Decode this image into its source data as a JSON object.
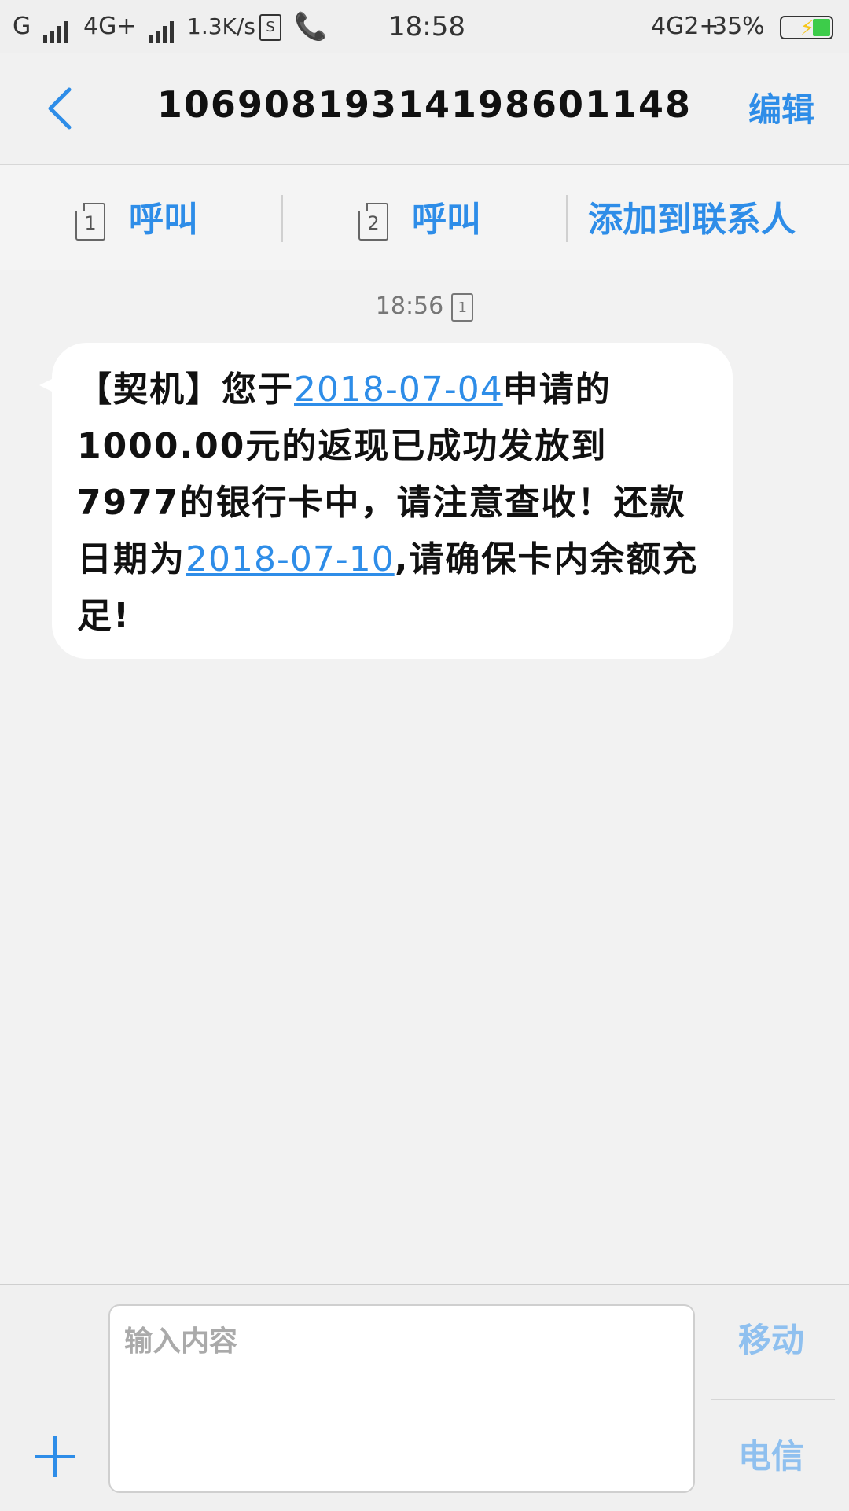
{
  "status_bar": {
    "carrier1": "G",
    "carrier2": "4G+",
    "speed": "1.3K/s",
    "sim_badge": "S",
    "time": "18:58",
    "network2": "4G2+",
    "battery_percent": "35%",
    "battery_level": 0.35
  },
  "header": {
    "title": "106908193141986​01148",
    "edit_label": "编辑"
  },
  "actions": {
    "call1_sim": "1",
    "call1_label": "呼叫",
    "call2_sim": "2",
    "call2_label": "呼叫",
    "add_contact_label": "添加到联系人"
  },
  "conversation": {
    "timestamp": "18:56",
    "timestamp_sim": "1",
    "message": {
      "part1": "【契机】您于",
      "date1": "2018-07-04",
      "part2": "申请的1000.00元的返现已成功发放到7977的银行卡中，请注意查收！还款日期为",
      "date2": "2018-07-10",
      "part3": ",请确保卡内余额充足!"
    }
  },
  "composer": {
    "placeholder": "输入内容",
    "send_sim1_label": "移动",
    "send_sim2_label": "电信"
  },
  "colors": {
    "accent": "#2e8de8",
    "background": "#f2f2f2",
    "bubble": "#ffffff",
    "send_label": "#8fc0ef"
  }
}
